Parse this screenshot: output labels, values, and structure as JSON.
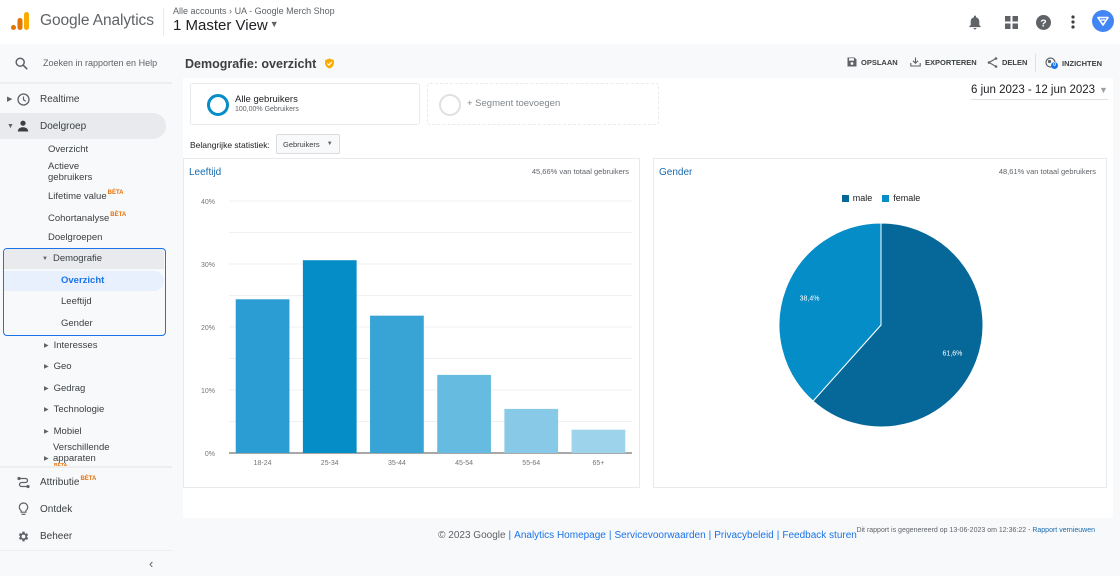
{
  "header": {
    "brand": "Google Analytics",
    "breadcrumb": [
      "Alle accounts",
      "UA - Google Merch Shop"
    ],
    "breadcrumb_sep": "›",
    "view": "1 Master View",
    "icons": [
      "bell-icon",
      "apps-grid-icon",
      "help-icon",
      "more-vert-icon",
      "avatar"
    ]
  },
  "sidebar": {
    "search_placeholder": "Zoeken in rapporten en Help",
    "realtime": "Realtime",
    "doelgroep": "Doelgroep",
    "doelgroep_items": [
      {
        "label": "Overzicht"
      },
      {
        "label": "Actieve gebruikers"
      },
      {
        "label": "Lifetime value",
        "badge": "BÈTA"
      },
      {
        "label": "Cohortanalyse",
        "badge": "BÈTA"
      },
      {
        "label": "Doelgroepen"
      }
    ],
    "demografie": {
      "label": "Demografie",
      "items": [
        "Overzicht",
        "Leeftijd",
        "Gender"
      ],
      "selected": "Overzicht"
    },
    "collapsed_groups": [
      "Interesses",
      "Geo",
      "Gedrag",
      "Technologie",
      "Mobiel",
      "Verschillende apparaten"
    ],
    "cross_device_badge": "BÈTA",
    "attributie": "Attributie",
    "attributie_badge": "BÈTA",
    "ontdek": "Ontdek",
    "beheer": "Beheer"
  },
  "main": {
    "title": "Demografie: overzicht",
    "actions": {
      "save": "OPSLAAN",
      "export": "EXPORTEREN",
      "share": "DELEN",
      "insights": "INZICHTEN",
      "insights_badge": "0"
    },
    "segment": {
      "name": "Alle gebruikers",
      "detail": "100,00% Gebruikers",
      "add": "+ Segment toevoegen"
    },
    "date_range": "6 jun 2023 - 12 jun 2023",
    "key_stat_label": "Belangrijke statistiek:",
    "key_stat_value": "Gebruikers",
    "generated_text": "Dit rapport is gegenereerd op 13-06-2023 om 12:36:22 -",
    "refresh_link": "Rapport vernieuwen"
  },
  "chart_data": [
    {
      "type": "bar",
      "title": "Leeftijd",
      "subtitle": "45,66% van totaal gebruikers",
      "categories": [
        "18-24",
        "25-34",
        "35-44",
        "45-54",
        "55-64",
        "65+"
      ],
      "values": [
        24.4,
        30.6,
        21.8,
        12.4,
        7.0,
        3.7
      ],
      "colors": [
        "#2c9dd3",
        "#058dc7",
        "#37a4d5",
        "#66bbe0",
        "#88c9e8",
        "#9dd4ec"
      ],
      "yticks": [
        "0%",
        "10%",
        "20%",
        "30%",
        "40%"
      ],
      "ylim": [
        0,
        40
      ],
      "grid": true,
      "xlabel": "",
      "ylabel": ""
    },
    {
      "type": "pie",
      "title": "Gender",
      "subtitle": "48,61% van totaal gebruikers",
      "legend_position": "top",
      "slices": [
        {
          "label": "male",
          "value": 61.6,
          "display": "61,6%",
          "color": "#066899"
        },
        {
          "label": "female",
          "value": 38.4,
          "display": "38,4%",
          "color": "#058dc7"
        }
      ]
    }
  ],
  "footer": {
    "copyright": "© 2023 Google",
    "links": [
      "Analytics Homepage",
      "Servicevoorwaarden",
      "Privacybeleid",
      "Feedback sturen"
    ]
  }
}
